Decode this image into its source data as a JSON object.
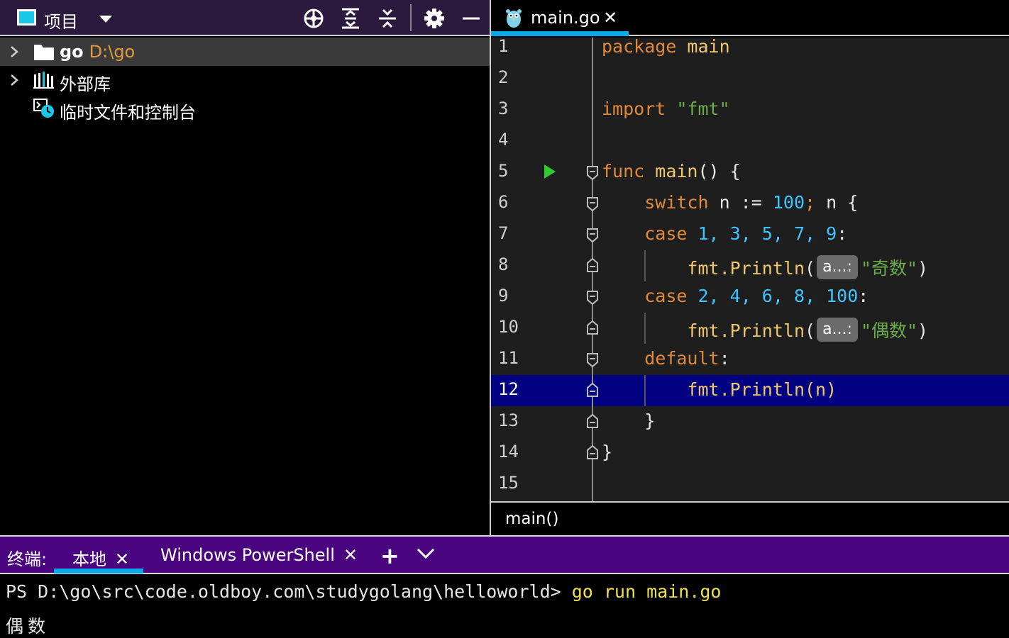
{
  "project_panel": {
    "title": "项目",
    "tree": [
      {
        "name": "go",
        "path": "D:\\go",
        "selected": true,
        "expandable": true
      },
      {
        "name": "外部库",
        "expandable": true
      },
      {
        "name": "临时文件和控制台",
        "expandable": false
      }
    ]
  },
  "editor": {
    "tab": {
      "filename": "main.go",
      "close": "✕"
    },
    "lines": [
      {
        "n": "1"
      },
      {
        "n": "2"
      },
      {
        "n": "3"
      },
      {
        "n": "4"
      },
      {
        "n": "5"
      },
      {
        "n": "6"
      },
      {
        "n": "7"
      },
      {
        "n": "8"
      },
      {
        "n": "9"
      },
      {
        "n": "10"
      },
      {
        "n": "11"
      },
      {
        "n": "12"
      },
      {
        "n": "13"
      },
      {
        "n": "14"
      },
      {
        "n": "15"
      }
    ],
    "code": {
      "l1_kw": "package",
      "l1_name": "main",
      "l3_kw": "import",
      "l3_str": "\"fmt\"",
      "l5_kw": "func",
      "l5_fn": "main",
      "l5_rest": "() {",
      "l6_kw": "switch",
      "l6_a": " n := ",
      "l6_num": "100",
      "l6_semi": ";",
      "l6_b": " n {",
      "l7_kw": "case",
      "l7_nums": "1, 3, 5, 7, 9",
      "l7_colon": ":",
      "l8_pkg": "fmt.",
      "l8_fn": "Println",
      "l8_open": "(",
      "l8_hint": "a...:",
      "l8_str": "\"奇数\"",
      "l8_close": ")",
      "l9_kw": "case",
      "l9_nums": "2, 4, 6, 8, 100",
      "l9_colon": ":",
      "l10_pkg": "fmt.",
      "l10_fn": "Println",
      "l10_open": "(",
      "l10_hint": "a...:",
      "l10_str": "\"偶数\"",
      "l10_close": ")",
      "l11_kw": "default",
      "l11_colon": ":",
      "l12_pkg": "fmt.",
      "l12_fn": "Println",
      "l12_args": "(n)",
      "l13": "}",
      "l14": "}"
    },
    "highlighted_line": "12",
    "breadcrumb": "main()"
  },
  "terminal": {
    "label": "终端:",
    "tabs": [
      {
        "name": "本地",
        "active": true,
        "close": "✕"
      },
      {
        "name": "Windows PowerShell",
        "active": false,
        "close": "✕"
      }
    ],
    "add": "+",
    "prompt": "PS D:\\go\\src\\code.oldboy.com\\studygolang\\helloworld> ",
    "command": "go run main.go",
    "output": "偶数"
  },
  "colors": {
    "project_header_bg": "#2b1a3d",
    "terminal_header_bg": "#4a0480",
    "accent": "#0aa8e6",
    "keyword": "#e08a3a",
    "number": "#3cc4ff",
    "string": "#6aab4a",
    "function": "#f0c86c",
    "highlight_line": "#000080"
  }
}
